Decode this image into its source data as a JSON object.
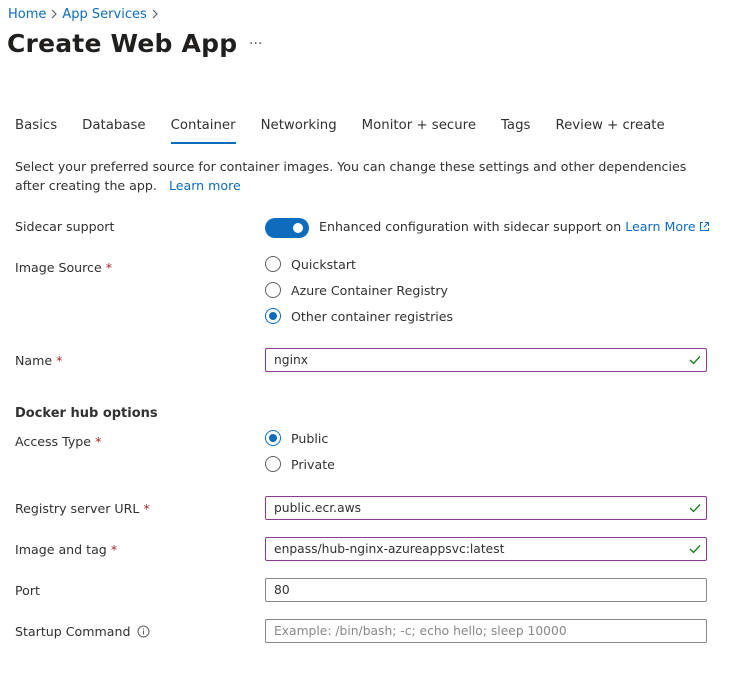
{
  "breadcrumb": {
    "items": [
      "Home",
      "App Services"
    ]
  },
  "page": {
    "title": "Create Web App",
    "more": "···"
  },
  "tabs": [
    "Basics",
    "Database",
    "Container",
    "Networking",
    "Monitor + secure",
    "Tags",
    "Review + create"
  ],
  "active_tab": "Container",
  "intro": {
    "text": "Select your preferred source for container images. You can change these settings and other dependencies after creating the app.",
    "link": "Learn more"
  },
  "sidecar": {
    "label": "Sidecar support",
    "enabled": true,
    "text": "Enhanced configuration with sidecar support on",
    "link": "Learn More"
  },
  "image_source": {
    "label": "Image Source",
    "required": "*",
    "options": [
      "Quickstart",
      "Azure Container Registry",
      "Other container registries"
    ],
    "selected": "Other container registries"
  },
  "name_field": {
    "label": "Name",
    "required": "*",
    "value": "nginx"
  },
  "docker": {
    "section_title": "Docker hub options",
    "access_type": {
      "label": "Access Type",
      "required": "*",
      "options": [
        "Public",
        "Private"
      ],
      "selected": "Public"
    },
    "registry_url": {
      "label": "Registry server URL",
      "required": "*",
      "value": "public.ecr.aws"
    },
    "image_tag": {
      "label": "Image and tag",
      "required": "*",
      "value": "enpass/hub-nginx-azureappsvc:latest"
    },
    "port": {
      "label": "Port",
      "value": "80"
    },
    "startup": {
      "label": "Startup Command",
      "value": "",
      "placeholder": "Example: /bin/bash; -c; echo hello; sleep 10000"
    }
  },
  "colors": {
    "accent": "#0f6cbd",
    "required": "#a4262c",
    "valid_border": "#8a3a8f",
    "valid_check": "#107c10"
  }
}
